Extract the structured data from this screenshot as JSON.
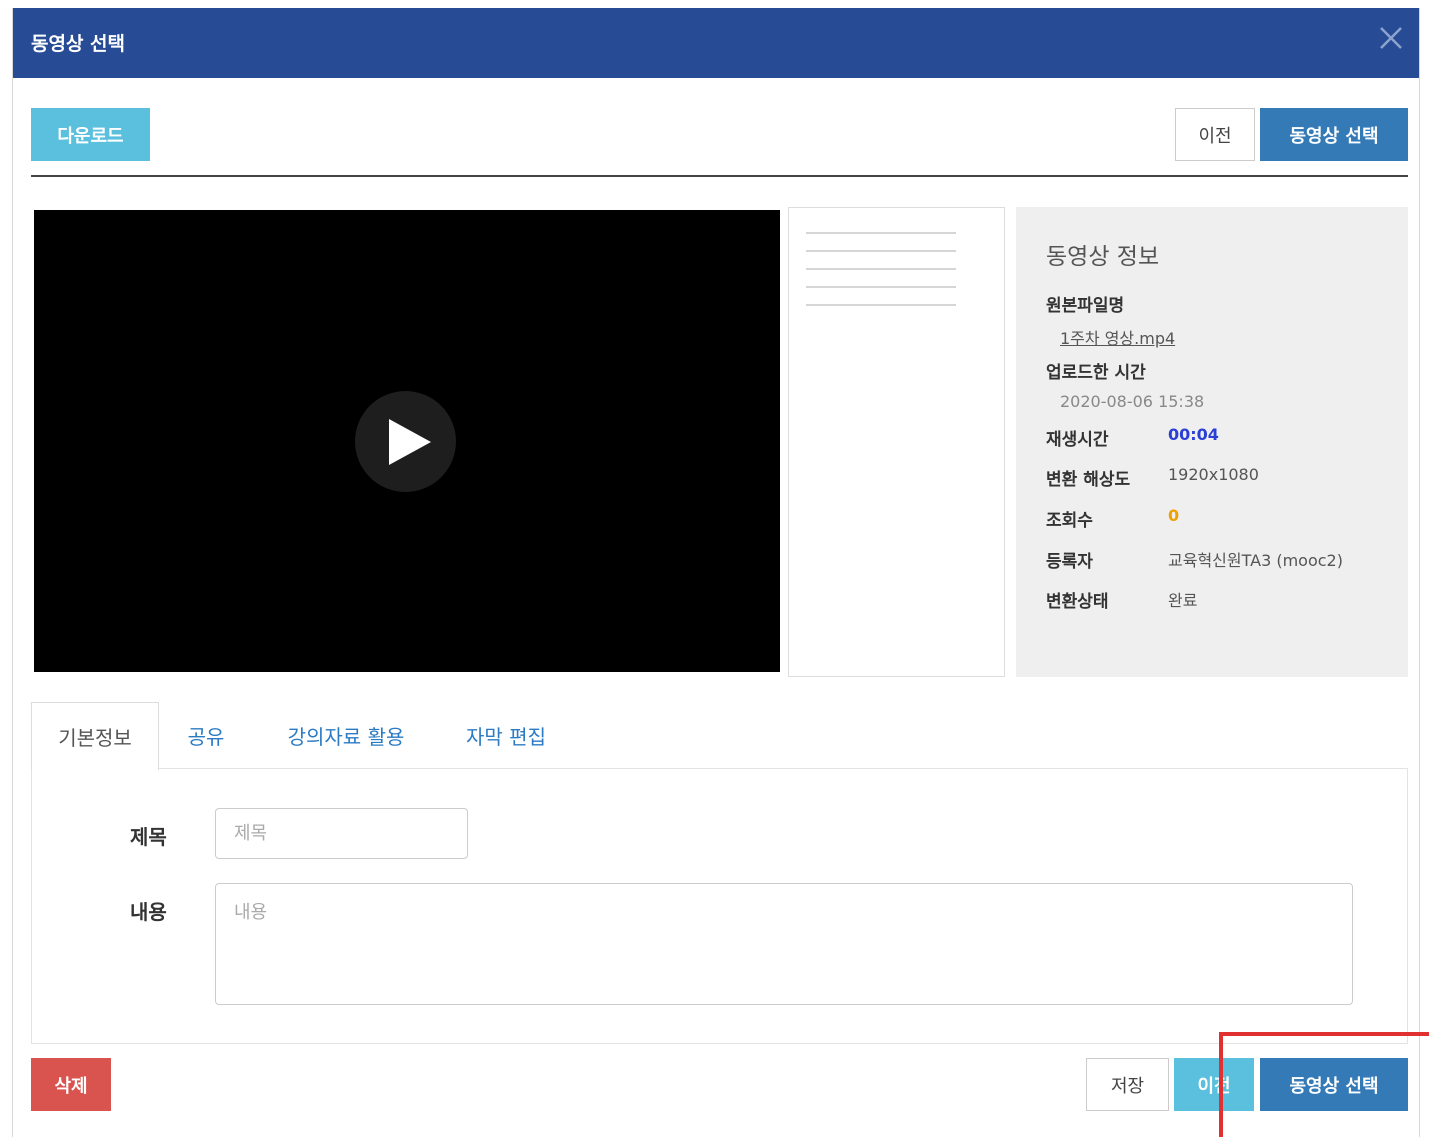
{
  "dialog": {
    "title": "동영상 선택"
  },
  "toolbar": {
    "download_label": "다운로드",
    "prev_label": "이전",
    "select_label": "동영상 선택"
  },
  "video_info": {
    "heading": "동영상 정보",
    "original_filename_label": "원본파일명",
    "original_filename": "1주차 영상.mp4",
    "upload_time_label": "업로드한 시간",
    "upload_time": "2020-08-06 15:38",
    "play_time_label": "재생시간",
    "play_time": "00:04",
    "resolution_label": "변환 해상도",
    "resolution": "1920x1080",
    "views_label": "조회수",
    "views": "0",
    "registrant_label": "등록자",
    "registrant": "교육혁신원TA3 (mooc2)",
    "status_label": "변환상태",
    "status": "완료",
    "colors": {
      "play_time": "#2a3fd6",
      "views": "#f0a000"
    }
  },
  "tabs": [
    {
      "label": "기본정보",
      "active": true
    },
    {
      "label": "공유",
      "active": false
    },
    {
      "label": "강의자료 활용",
      "active": false
    },
    {
      "label": "자막 편집",
      "active": false
    }
  ],
  "form": {
    "title_label": "제목",
    "title_placeholder": "제목",
    "content_label": "내용",
    "content_placeholder": "내용"
  },
  "footer": {
    "delete_label": "삭제",
    "save_label": "저장",
    "prev_label": "이전",
    "select_label": "동영상 선택"
  },
  "colors": {
    "header": "#274b94",
    "primary": "#337ab7",
    "info": "#5bc0de",
    "danger": "#d9534f",
    "highlight": "#e03030"
  }
}
